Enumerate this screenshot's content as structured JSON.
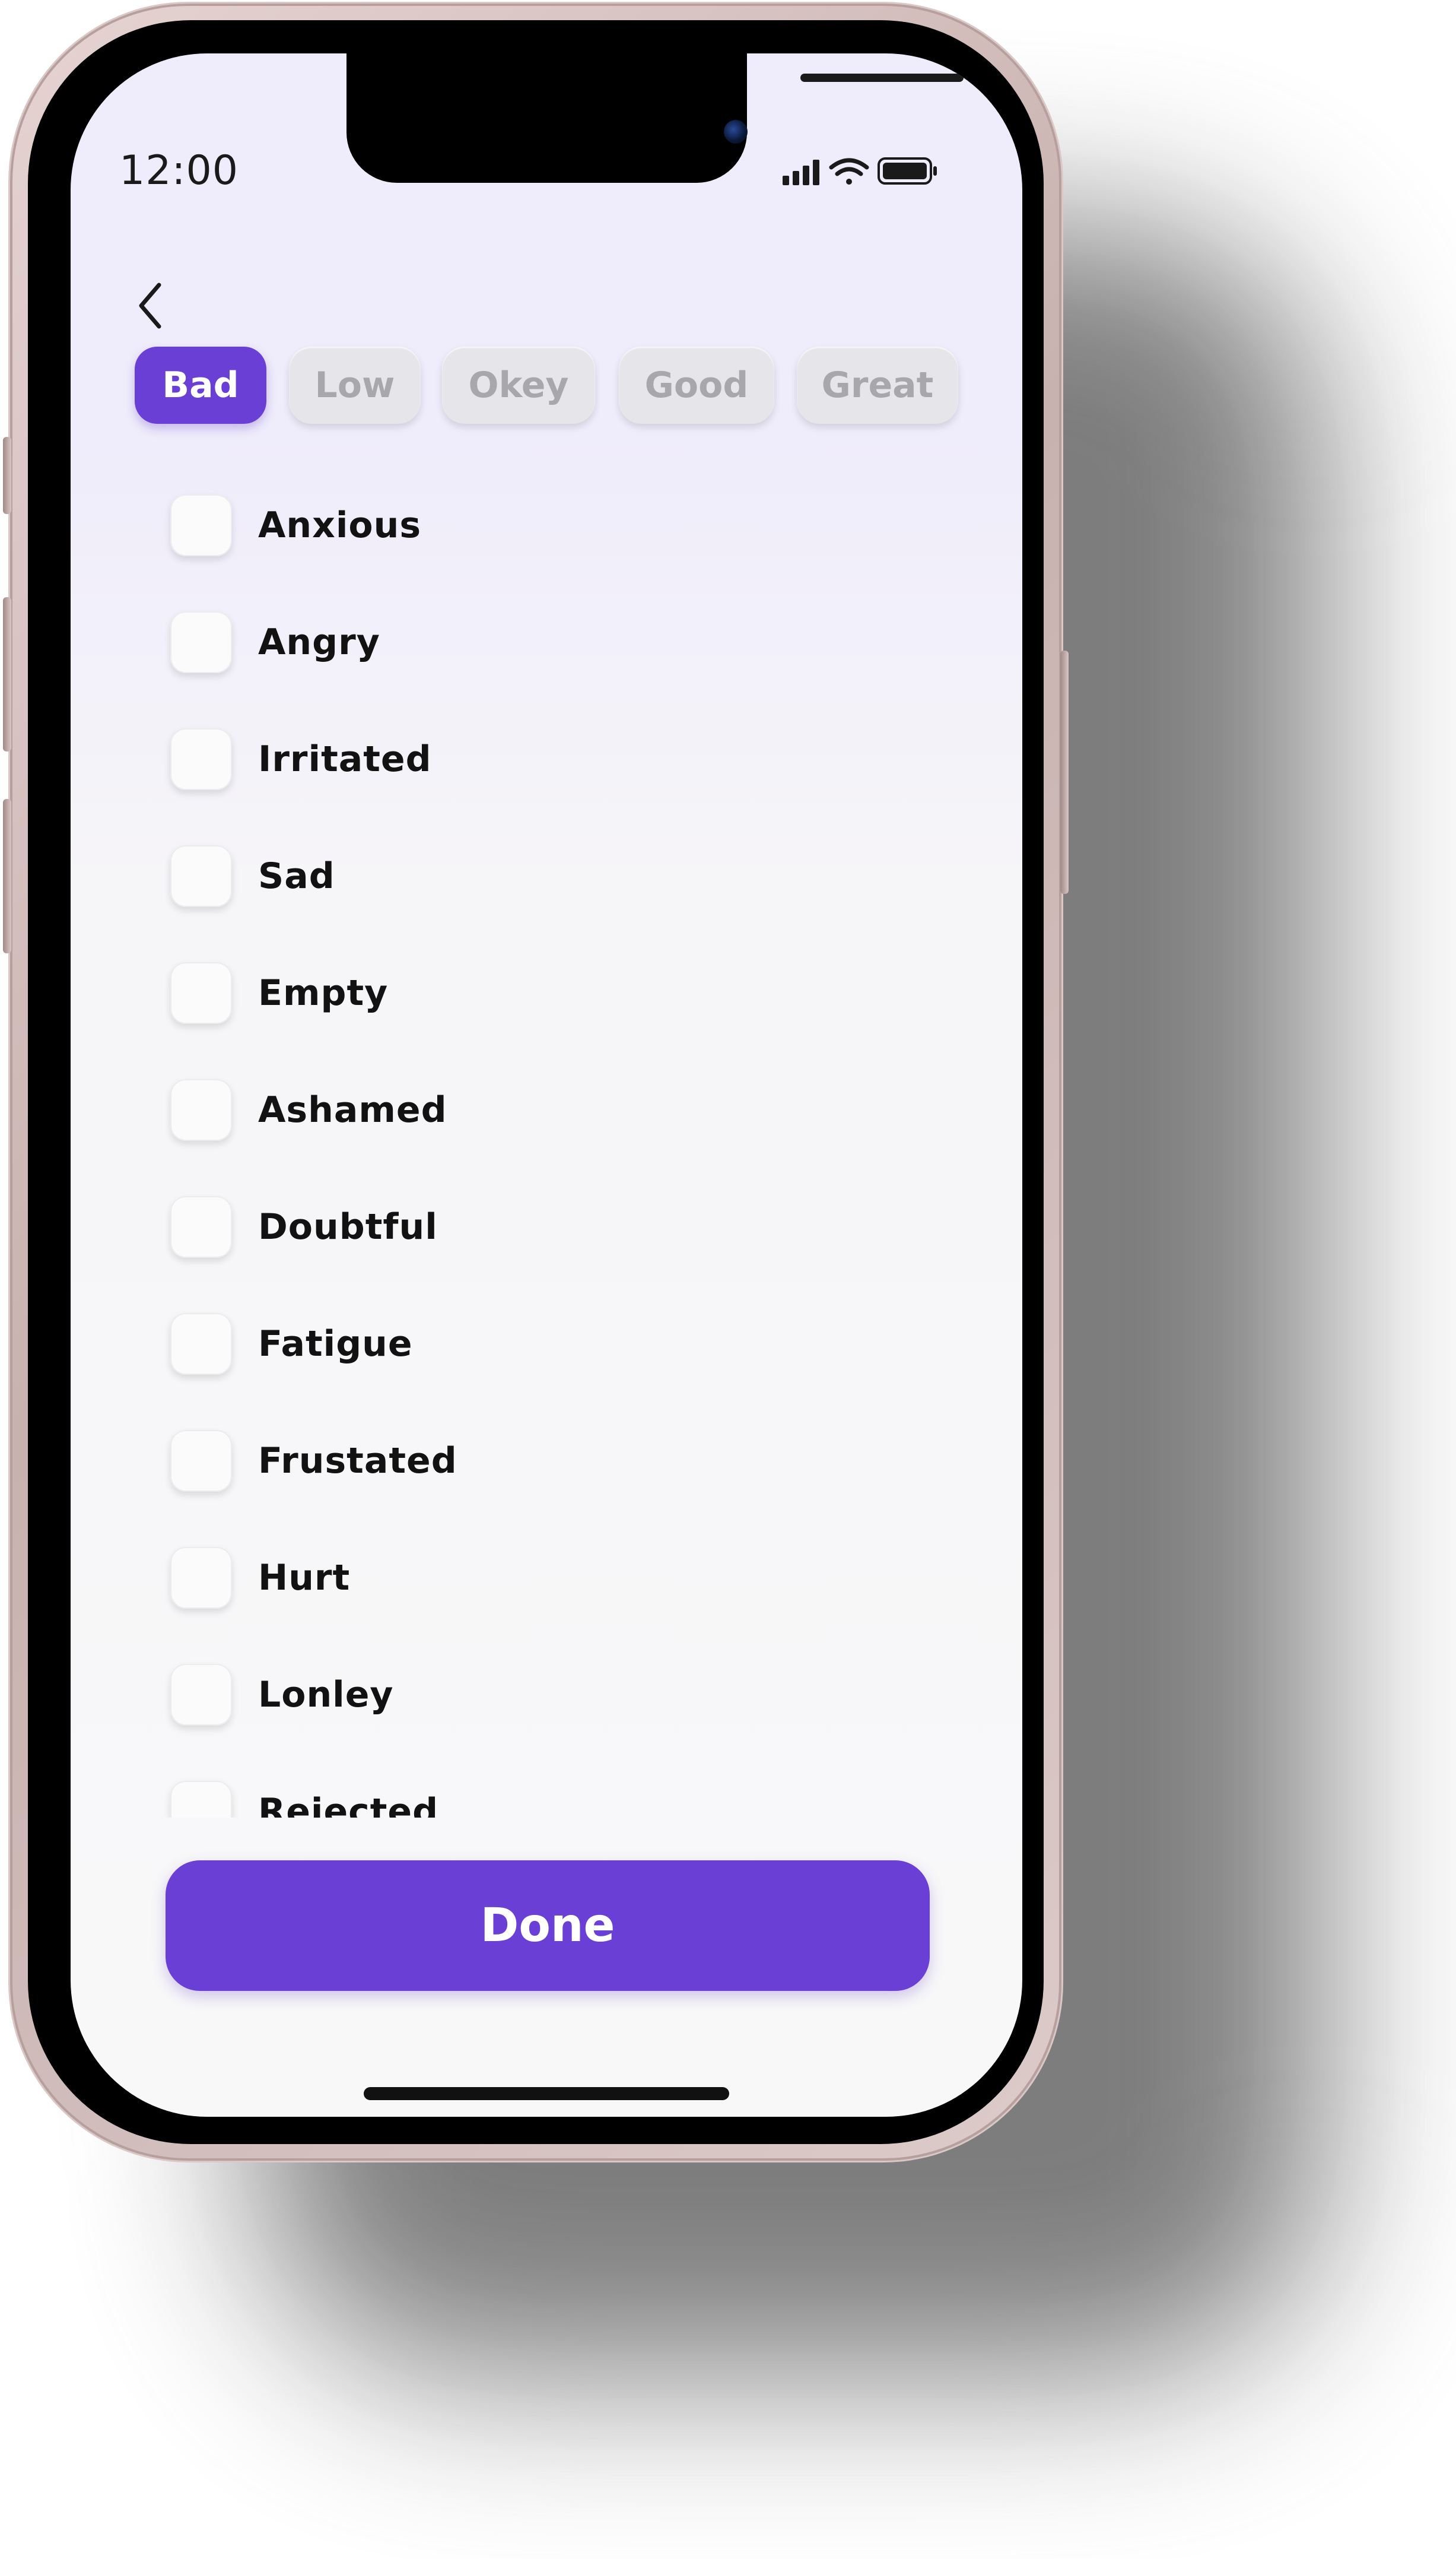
{
  "status_bar": {
    "time": "12:00",
    "icons": [
      "signal-icon",
      "wifi-icon",
      "battery-icon"
    ]
  },
  "nav": {
    "back_icon": "chevron-left-icon"
  },
  "mood_tabs": {
    "active_index": 0,
    "items": [
      {
        "label": "Bad",
        "active": true
      },
      {
        "label": "Low",
        "active": false
      },
      {
        "label": "Okey",
        "active": false
      },
      {
        "label": "Good",
        "active": false
      },
      {
        "label": "Great",
        "active": false
      }
    ]
  },
  "feelings": [
    {
      "label": "Anxious",
      "checked": false
    },
    {
      "label": "Angry",
      "checked": false
    },
    {
      "label": "Irritated",
      "checked": false
    },
    {
      "label": "Sad",
      "checked": false
    },
    {
      "label": "Empty",
      "checked": false
    },
    {
      "label": "Ashamed",
      "checked": false
    },
    {
      "label": "Doubtful",
      "checked": false
    },
    {
      "label": "Fatigue",
      "checked": false
    },
    {
      "label": "Frustated",
      "checked": false
    },
    {
      "label": "Hurt",
      "checked": false
    },
    {
      "label": "Lonley",
      "checked": false
    },
    {
      "label": "Rejected",
      "checked": false
    }
  ],
  "actions": {
    "done_label": "Done"
  },
  "colors": {
    "accent": "#6a3fd5",
    "inactive_tab_bg": "#e6e5ea",
    "inactive_tab_text": "#a8a8ac",
    "text": "#121212"
  }
}
